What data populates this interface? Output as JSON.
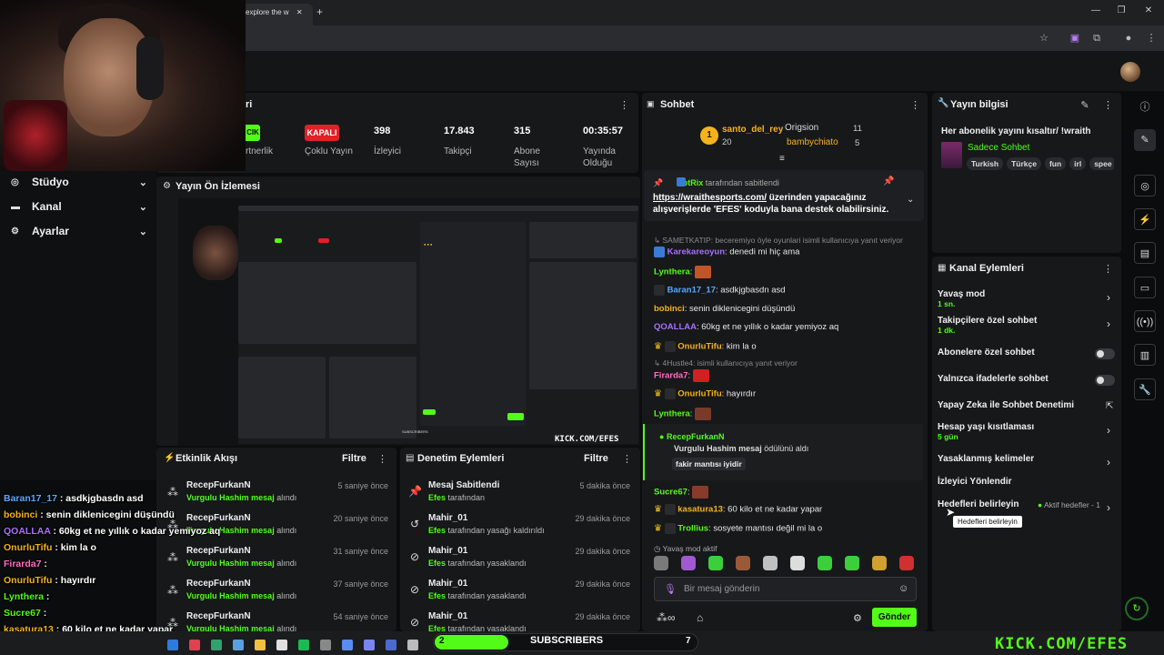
{
  "browser": {
    "tab_title": "explore the w",
    "new_tab": "+",
    "controls": [
      "—",
      "❐",
      "✕"
    ]
  },
  "sidebar": {
    "items": [
      {
        "label": "Stüdyo",
        "icon": "studio-icon"
      },
      {
        "label": "Kanal",
        "icon": "channel-icon"
      },
      {
        "label": "Ayarlar",
        "icon": "gear-icon"
      }
    ]
  },
  "stats": {
    "partial_title": "ri",
    "partner_badge": "CIK",
    "partner_label": "rtnerlik",
    "multistream_badge": "KAPALI",
    "multistream_label": "Çoklu Yayın",
    "viewers_value": "398",
    "viewers_label": "İzleyici",
    "followers_value": "17.843",
    "followers_label": "Takipçi",
    "subs_value": "315",
    "subs_label": "Abone Sayısı",
    "uptime_value": "00:35:57",
    "uptime_label": "Yayında Olduğu"
  },
  "preview": {
    "title": "Yayın Ön İzlemesi",
    "watermark": "KICK.COM/EFES",
    "subscribers_mini": "SUBSCRIBERS"
  },
  "events": {
    "title": "Etkinlik Akışı",
    "filter": "Filtre",
    "rows": [
      {
        "name": "RecepFurkanN",
        "item": "Vurgulu Hashim mesaj",
        "suffix": " alındı",
        "time": "5 saniye önce"
      },
      {
        "name": "RecepFurkanN",
        "item": "Vurgulu Hashim mesaj",
        "suffix": " alındı",
        "time": "20 saniye önce"
      },
      {
        "name": "RecepFurkanN",
        "item": "Vurgulu Hashim mesaj",
        "suffix": " alındı",
        "time": "31 saniye önce"
      },
      {
        "name": "RecepFurkanN",
        "item": "Vurgulu Hashim mesaj",
        "suffix": " alındı",
        "time": "37 saniye önce"
      },
      {
        "name": "RecepFurkanN",
        "item": "Vurgulu Hashim mesaj",
        "suffix": " alındı",
        "time": "54 saniye önce"
      }
    ]
  },
  "moderation": {
    "title": "Denetim Eylemleri",
    "filter": "Filtre",
    "rows": [
      {
        "name": "Mesaj Sabitlendi",
        "by": "Efes",
        "suffix": " tarafından",
        "time": "5 dakika önce",
        "icon": "pin-icon"
      },
      {
        "name": "Mahir_01",
        "by": "Efes",
        "suffix": " tarafından yasağı kaldırıldı",
        "time": "29 dakika önce",
        "icon": "undo-icon"
      },
      {
        "name": "Mahir_01",
        "by": "Efes",
        "suffix": " tarafından yasaklandı",
        "time": "29 dakika önce",
        "icon": "ban-icon"
      },
      {
        "name": "Mahir_01",
        "by": "Efes",
        "suffix": " tarafından yasaklandı",
        "time": "29 dakika önce",
        "icon": "ban-icon"
      },
      {
        "name": "Mahir_01",
        "by": "Efes",
        "suffix": " tarafından yasaklandı",
        "time": "29 dakika önce",
        "icon": "ban-icon"
      }
    ]
  },
  "chat": {
    "title": "Sohbet",
    "leaders": [
      {
        "rank": "1",
        "name": "santo_del_rey",
        "score": "20"
      },
      {
        "name": "Origsion",
        "score": "11"
      },
      {
        "name": "bambychiato",
        "score": "5"
      }
    ],
    "pinned": {
      "by": "BotRix",
      "by_suffix": "tarafından sabitlendi",
      "link": "https://wraithesports.com/",
      "text1": " üzerinden yapacağınız",
      "text2": "alışverişlerde 'EFES' koduyla bana destek olabilirsiniz."
    },
    "reply1": "SAMETKATIP: beceremiyo öyle oyunlari isimli kullanıcıya yanıt veriyor",
    "msg1_user": "Karekareoyun",
    "msg1_text": ": denedi mi hiç ama",
    "msg2_user": "Lynthera",
    "msg3_user": "Baran17_17",
    "msg3_text": ": asdkjgbasdn asd",
    "msg4_user": "bobinci",
    "msg4_text": ": senin diklenicegini düşündü",
    "msg5_user": "QOALLAA",
    "msg5_text": ": 60kg et ne yıllık o kadar yemiyoz aq",
    "msg6_user": "OnurluTifu",
    "msg6_text": ": kim la o",
    "reply2": "4Hustle4: isimli kullanıcıya yanıt veriyor",
    "msg7_user": "Firarda7",
    "msg8_user": "OnurluTifu",
    "msg8_text": ": hayırdır",
    "msg9_user": "Lynthera",
    "reward_user": "RecepFurkanN",
    "reward_text": "Vurgulu Hashim mesaj",
    "reward_suffix": " ödülünü aldı",
    "reward_msg": "fakir mantısı iyidir",
    "msg10_user": "Sucre67",
    "msg11_user": "kasatura13",
    "msg11_text": ": 60 kilo et ne kadar yapar",
    "msg12_user": "Trollius",
    "msg12_text": ": sosyete mantısı değil mi la o",
    "slow_mode": "Yavaş mod aktif",
    "input_placeholder": "Bir mesaj gönderin",
    "send_label": "Gönder"
  },
  "stream_info": {
    "title": "Yayın bilgisi",
    "stream_title": "Her abonelik yayını kısaltır/ !wraith",
    "category": "Sadece Sohbet",
    "tags": [
      "Turkish",
      "Türkçe",
      "fun",
      "irl",
      "spee"
    ]
  },
  "channel_actions": {
    "title": "Kanal Eylemleri",
    "rows": [
      {
        "label": "Yavaş mod",
        "sub": "1 sn."
      },
      {
        "label": "Takipçilere özel sohbet",
        "sub": "1 dk."
      },
      {
        "label": "Abonelere özel sohbet",
        "sub": ""
      },
      {
        "label": "Yalnızca ifadelerle sohbet",
        "sub": ""
      },
      {
        "label": "Yapay Zeka ile Sohbet Denetimi",
        "sub": ""
      },
      {
        "label": "Hesap yaşı kısıtlaması",
        "sub": "5 gün"
      },
      {
        "label": "Yasaklanmış kelimeler",
        "sub": ""
      },
      {
        "label": "İzleyici Yönlendir",
        "sub": ""
      },
      {
        "label": "Hedefleri belirleyin",
        "sub": ""
      }
    ],
    "active_goals": "Aktif hedefler - 1",
    "tooltip": "Hedefleri belirleyin"
  },
  "overlay_chat": [
    {
      "user": "Baran17_17",
      "text": " : asdkjgbasdn asd",
      "color": "#5aa9ff"
    },
    {
      "user": "bobinci",
      "text": " : senin diklenicegini düşündü",
      "color": "#f5b31b"
    },
    {
      "user": "QOALLAA",
      "text": " : 60kg et ne yıllık o kadar yemiyoz aq",
      "color": "#a970ff"
    },
    {
      "user": "OnurluTifu",
      "text": " : kim la o",
      "color": "#f5b31b"
    },
    {
      "user": "Firarda7",
      "text": " :",
      "color": "#ff6ec7"
    },
    {
      "user": "OnurluTifu",
      "text": " : hayırdır",
      "color": "#f5b31b"
    },
    {
      "user": "Lynthera",
      "text": " :",
      "color": "#53fc18"
    },
    {
      "user": "Sucre67",
      "text": " :",
      "color": "#53fc18"
    },
    {
      "user": "kasatura13",
      "text": " : 60 kilo et ne kadar yapar",
      "color": "#f5b31b"
    },
    {
      "user": "Trollius",
      "text": " : sosyete mantısı değil mi la o",
      "color": "#53fc18"
    }
  ],
  "subscribers_bar": {
    "current": "2",
    "label": "SUBSCRIBERS",
    "goal": "7",
    "progress_fraction": 0.28
  },
  "brand": "KICK.COM/EFES",
  "colors": {
    "accent": "#53fc18",
    "danger": "#e0202a",
    "panel": "#17181a",
    "background": "#0b0c0d"
  }
}
